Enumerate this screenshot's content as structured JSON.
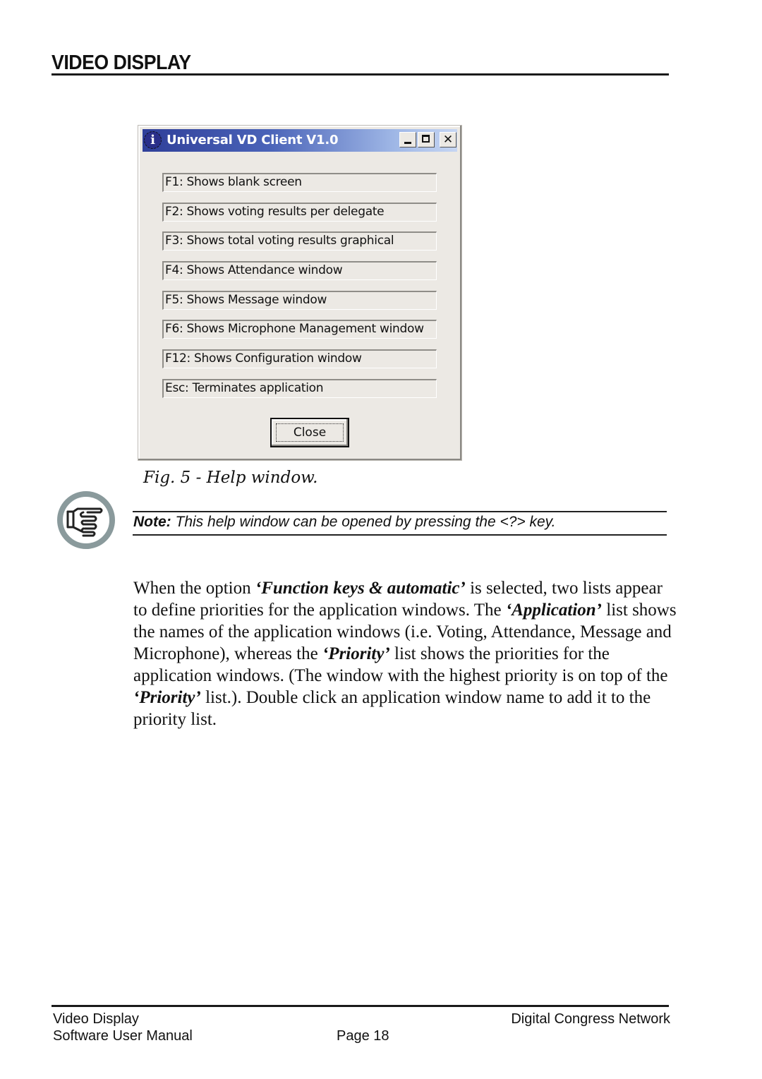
{
  "header": {
    "title": "VIDEO DISPLAY"
  },
  "window": {
    "title": "Universal VD Client V1.0",
    "icon": "info-icon",
    "controls": {
      "minimize": "_",
      "maximize": "□",
      "close": "✕"
    },
    "items": [
      "F1: Shows blank screen",
      "F2: Shows voting results per delegate",
      "F3: Shows total voting results graphical",
      "F4: Shows Attendance window",
      "F5: Shows Message window",
      "F6: Shows Microphone Management window",
      "F12: Shows Configuration window",
      "Esc: Terminates application"
    ],
    "close_button": "Close"
  },
  "caption": "Fig. 5 - Help window.",
  "note": {
    "icon": "pointing-hand-icon",
    "label": "Note:",
    "text": " This help window can be opened by pressing the <?> key."
  },
  "body": {
    "p1_a": "When the option ",
    "p1_em1": "‘Function keys & automatic’",
    "p1_b": " is selected, two lists appear to define priorities for the application windows. The ",
    "p1_em2": "‘Application’",
    "p1_c": " list shows the names of the application windows (i.e. Voting, Attendance, Message and Microphone), whereas the ",
    "p1_em3": "‘Priority’",
    "p1_d": " list shows the priorities for the application windows. (The window with the highest priority is on top of the ",
    "p1_em4": "‘Priority’",
    "p1_e": " list.). Double click an application window name to add it to the priority list."
  },
  "footer": {
    "left_top": "Video Display",
    "left_bottom": "Software User Manual",
    "center": "Page 18",
    "right": "Digital Congress Network"
  }
}
